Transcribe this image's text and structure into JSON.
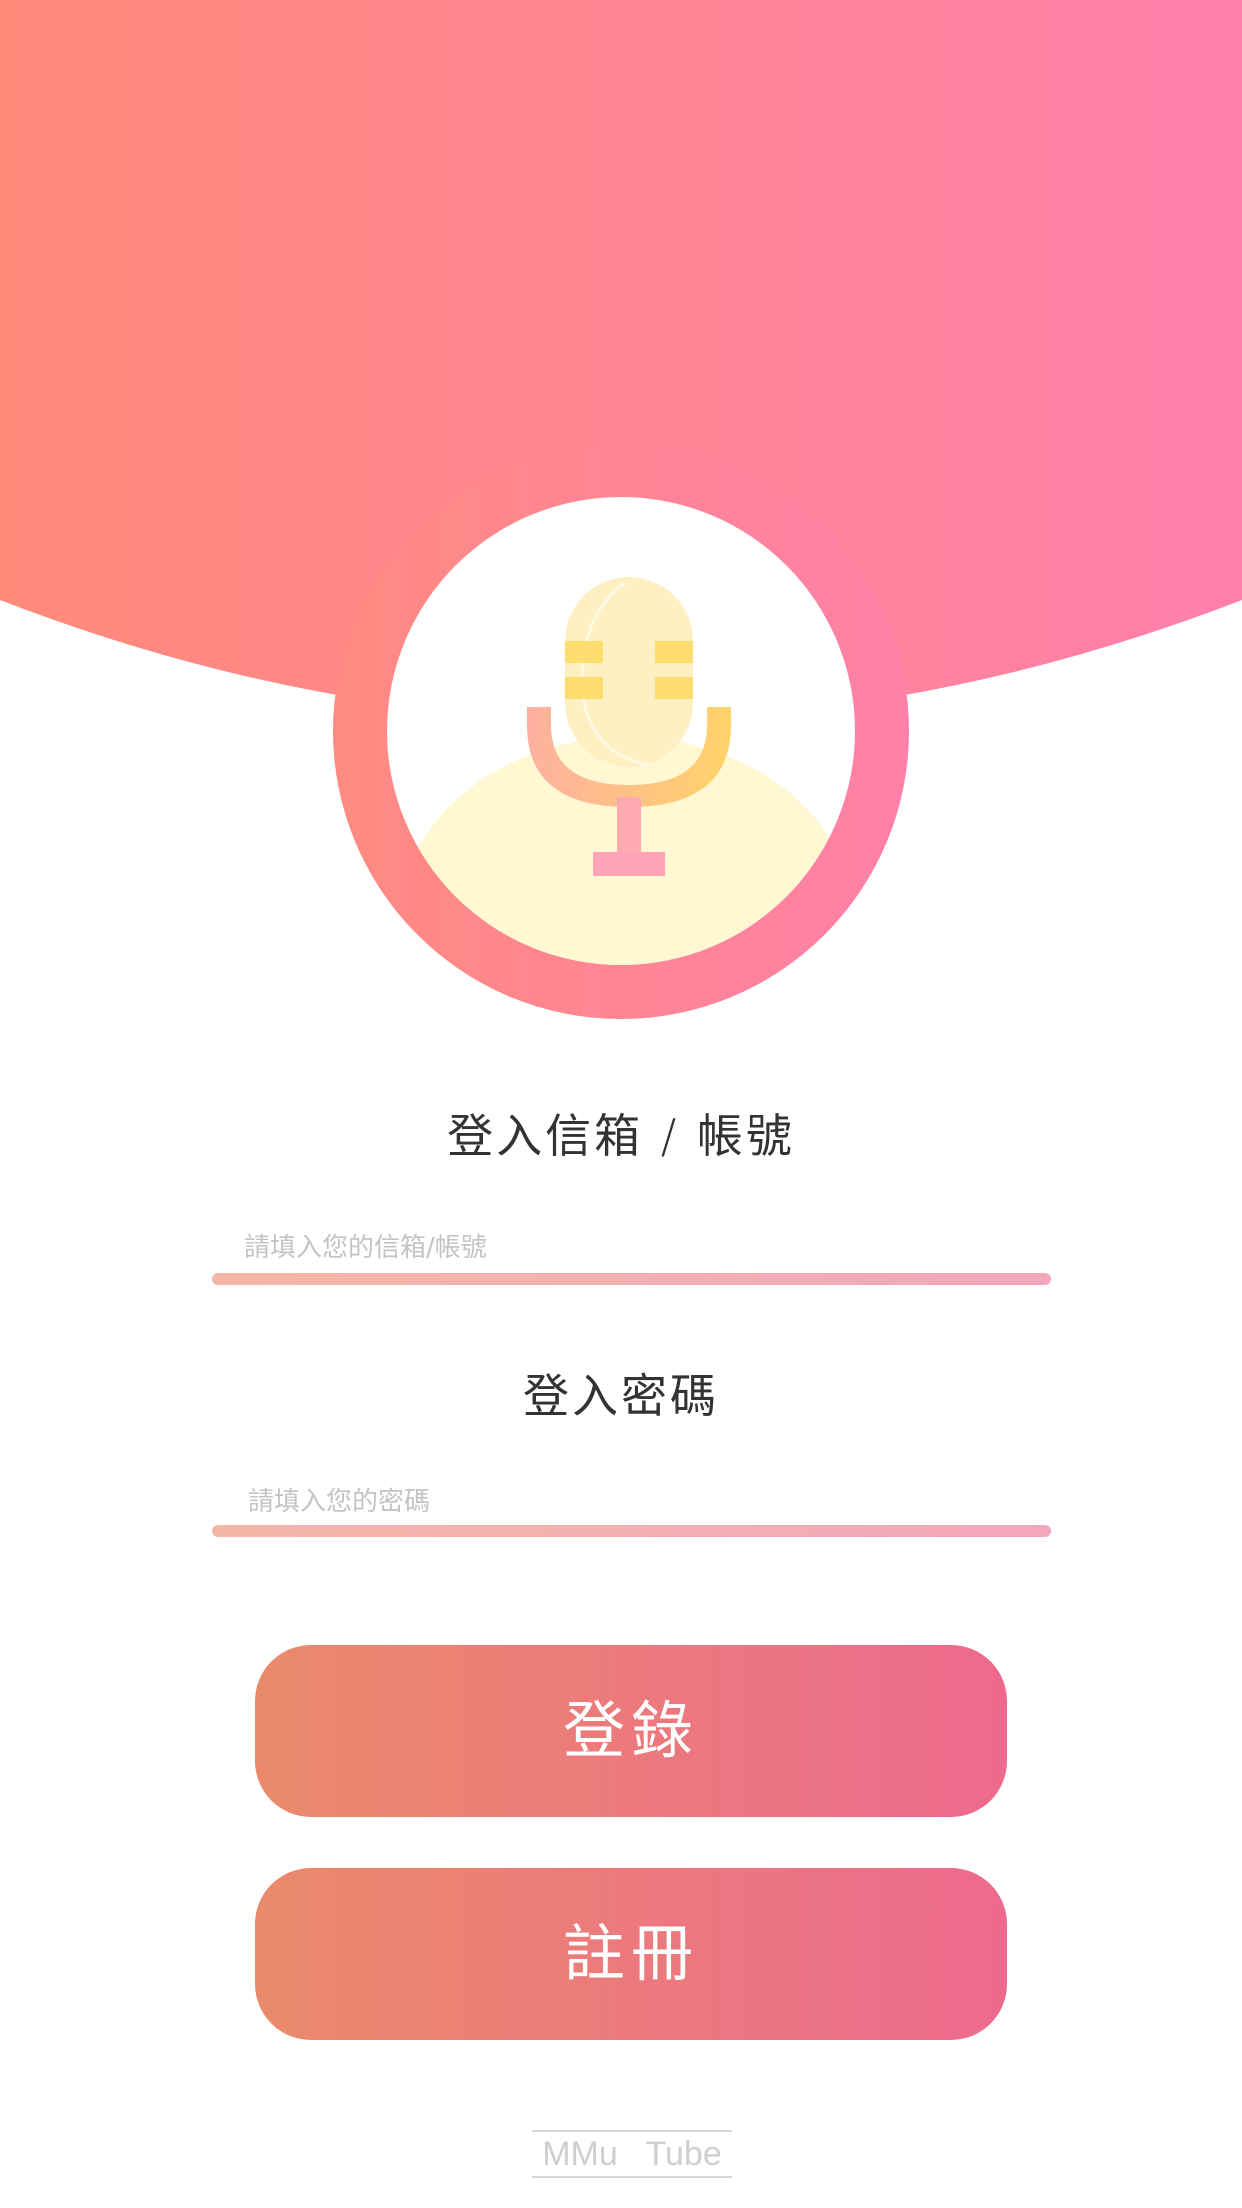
{
  "colors": {
    "header_gradient_start": "#ff8a7a",
    "header_gradient_end": "#ff7fab",
    "button_gradient_start": "#ea8a6b",
    "button_gradient_end": "#ed6a8e",
    "input_line_start": "#f4b7a6",
    "input_line_end": "#f3a7bd",
    "title_text": "#333333",
    "placeholder_text": "#c4c4c4",
    "footer_text": "#cfcfcf"
  },
  "logo": {
    "icon": "microphone-icon"
  },
  "form": {
    "email": {
      "label": "登入信箱 / 帳號",
      "placeholder": "請填入您的信箱/帳號",
      "value": ""
    },
    "password": {
      "label": "登入密碼",
      "placeholder": "請填入您的密碼",
      "value": ""
    }
  },
  "buttons": {
    "login_label": "登錄",
    "register_label": "註冊"
  },
  "footer": {
    "brand": "MMu   Tube"
  }
}
